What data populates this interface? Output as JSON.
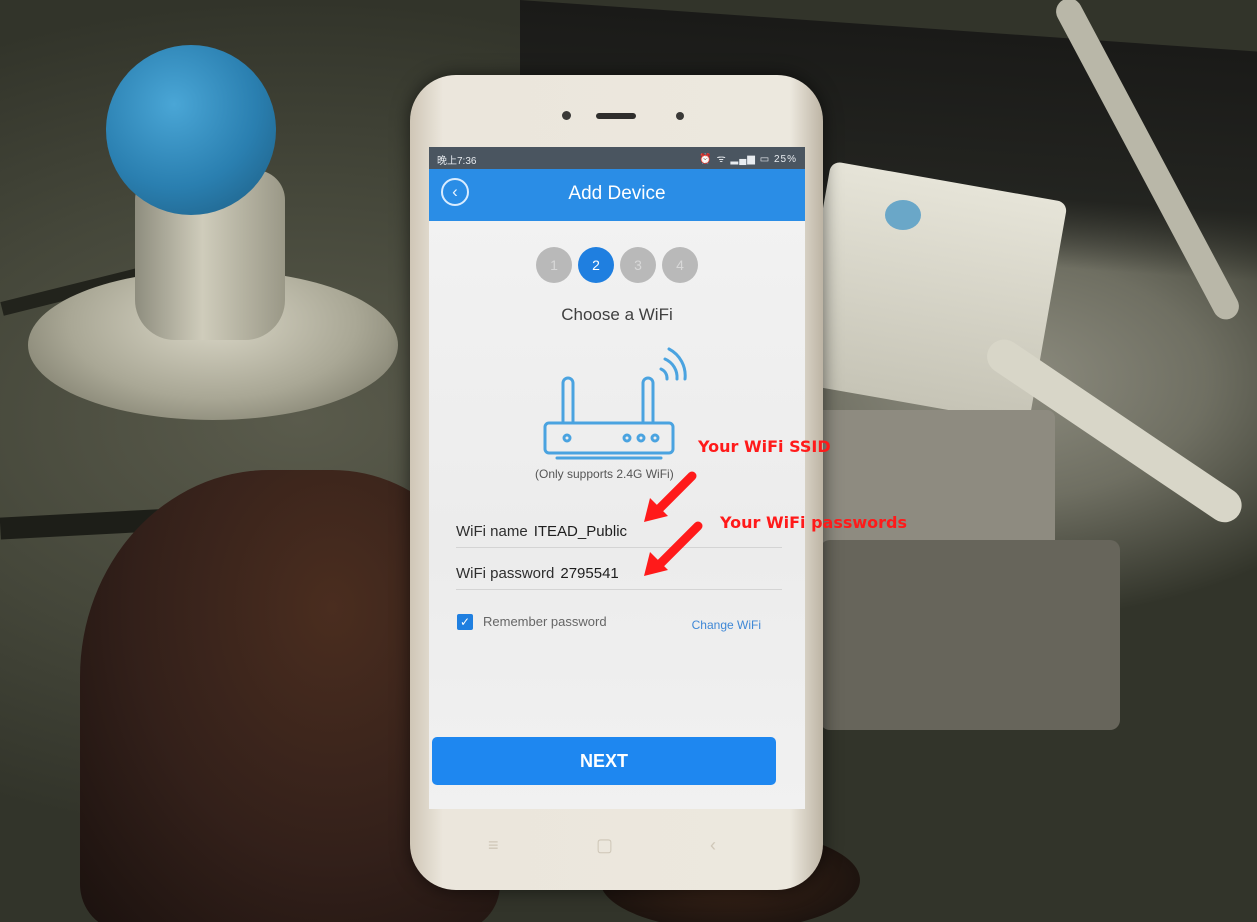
{
  "status_bar": {
    "time": "晚上7:36",
    "icons": "⏰ ᯤ ▂▄▆ ▭ 25%"
  },
  "app_bar": {
    "title": "Add Device",
    "back_icon": "‹"
  },
  "steps": [
    {
      "label": "1",
      "active": false
    },
    {
      "label": "2",
      "active": true
    },
    {
      "label": "3",
      "active": false
    },
    {
      "label": "4",
      "active": false
    }
  ],
  "heading": "Choose a WiFi",
  "router_note": "(Only supports 2.4G WiFi)",
  "wifi_name": {
    "label": "WiFi name",
    "value": "ITEAD_Public"
  },
  "wifi_password": {
    "label": "WiFi password",
    "value": "2795541"
  },
  "remember": {
    "label": "Remember password",
    "checked": true
  },
  "change_wifi_label": "Change WiFi",
  "next_label": "NEXT",
  "annotations": {
    "ssid": "Your WiFi SSID",
    "password": "Your WiFi passwords",
    "color": "#ff1a1a"
  },
  "colors": {
    "accent": "#2a8de6",
    "button": "#1e87f0"
  }
}
